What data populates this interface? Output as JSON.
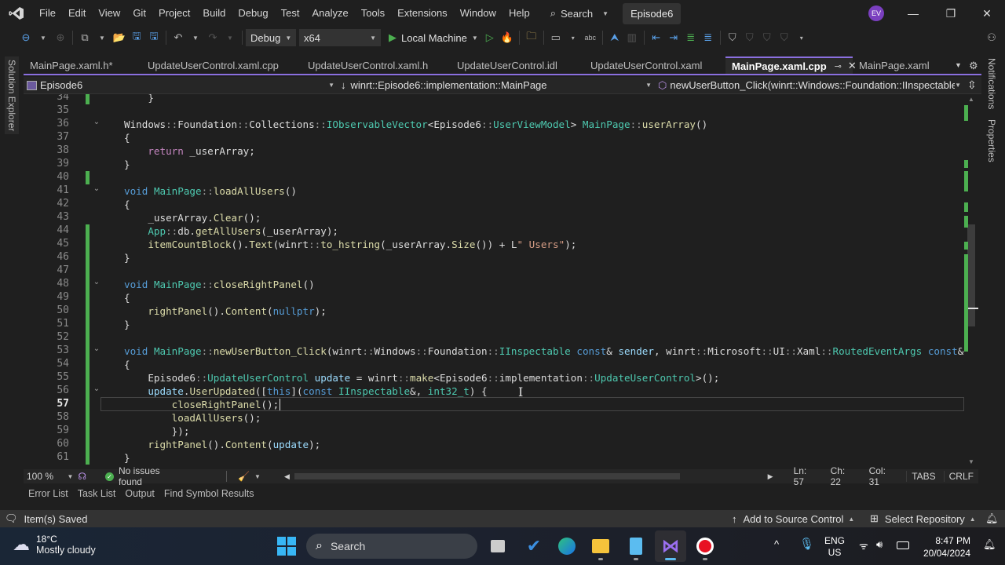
{
  "app": {
    "solution_name": "Episode6",
    "user_initials": "EV",
    "accent_color": "#8a6fdf"
  },
  "menu": {
    "items": [
      "File",
      "Edit",
      "View",
      "Git",
      "Project",
      "Build",
      "Debug",
      "Test",
      "Analyze",
      "Tools",
      "Extensions",
      "Window",
      "Help"
    ],
    "search_label": "Search"
  },
  "toolbar": {
    "configuration": "Debug",
    "platform": "x64",
    "run_target": "Local Machine"
  },
  "side_panels": {
    "left": "Solution Explorer",
    "right": [
      "Notifications",
      "Properties"
    ]
  },
  "tabs": [
    {
      "label": "MainPage.xaml.h*",
      "active": false
    },
    {
      "label": "UpdateUserControl.xaml.cpp",
      "active": false
    },
    {
      "label": "UpdateUserControl.xaml.h",
      "active": false
    },
    {
      "label": "UpdateUserControl.idl",
      "active": false
    },
    {
      "label": "UpdateUserControl.xaml",
      "active": false
    },
    {
      "label": "MainPage.xaml.cpp",
      "active": true
    },
    {
      "label": "MainPage.xaml",
      "active": false
    }
  ],
  "navbar": {
    "project": "Episode6",
    "scope": "winrt::Episode6::implementation::MainPage",
    "member": "newUserButton_Click(winrt::Windows::Foundation::IInspectable const"
  },
  "editor": {
    "current_line": 57,
    "lines": [
      {
        "n": 34,
        "text": "    }"
      },
      {
        "n": 35,
        "text": ""
      },
      {
        "n": 36,
        "text": "Windows::Foundation::Collections::IObservableVector<Episode6::UserViewModel> MainPage::userArray()"
      },
      {
        "n": 37,
        "text": "{"
      },
      {
        "n": 38,
        "text": "    return _userArray;"
      },
      {
        "n": 39,
        "text": "}"
      },
      {
        "n": 40,
        "text": ""
      },
      {
        "n": 41,
        "text": "void MainPage::loadAllUsers()"
      },
      {
        "n": 42,
        "text": "{"
      },
      {
        "n": 43,
        "text": "    _userArray.Clear();"
      },
      {
        "n": 44,
        "text": "    App::db.getAllUsers(_userArray);"
      },
      {
        "n": 45,
        "text": "    itemCountBlock().Text(winrt::to_hstring(_userArray.Size()) + L\" Users\");"
      },
      {
        "n": 46,
        "text": "}"
      },
      {
        "n": 47,
        "text": ""
      },
      {
        "n": 48,
        "text": "void MainPage::closeRightPanel()"
      },
      {
        "n": 49,
        "text": "{"
      },
      {
        "n": 50,
        "text": "    rightPanel().Content(nullptr);"
      },
      {
        "n": 51,
        "text": "}"
      },
      {
        "n": 52,
        "text": ""
      },
      {
        "n": 53,
        "text": "void MainPage::newUserButton_Click(winrt::Windows::Foundation::IInspectable const& sender, winrt::Microsoft::UI::Xaml::RoutedEventArgs const&"
      },
      {
        "n": 54,
        "text": "{"
      },
      {
        "n": 55,
        "text": "    Episode6::UpdateUserControl update = winrt::make<Episode6::implementation::UpdateUserControl>();"
      },
      {
        "n": 56,
        "text": "    update.UserUpdated([this](const IInspectable&, int32_t) {"
      },
      {
        "n": 57,
        "text": "        closeRightPanel();"
      },
      {
        "n": 58,
        "text": "        loadAllUsers();"
      },
      {
        "n": 59,
        "text": "        });"
      },
      {
        "n": 60,
        "text": "    rightPanel().Content(update);"
      },
      {
        "n": 61,
        "text": "}"
      }
    ]
  },
  "editor_status": {
    "zoom": "100 %",
    "issues": "No issues found",
    "line": "Ln: 57",
    "char": "Ch: 22",
    "col": "Col: 31",
    "indent": "TABS",
    "eol": "CRLF"
  },
  "bottom_tabs": [
    "Error List",
    "Task List",
    "Output",
    "Find Symbol Results"
  ],
  "status": {
    "message": "Item(s) Saved",
    "source_control": "Add to Source Control",
    "repository": "Select Repository"
  },
  "taskbar": {
    "weather_temp": "18°C",
    "weather_desc": "Mostly cloudy",
    "search_label": "Search",
    "lang_top": "ENG",
    "lang_bottom": "US",
    "time": "8:47 PM",
    "date": "20/04/2024"
  }
}
